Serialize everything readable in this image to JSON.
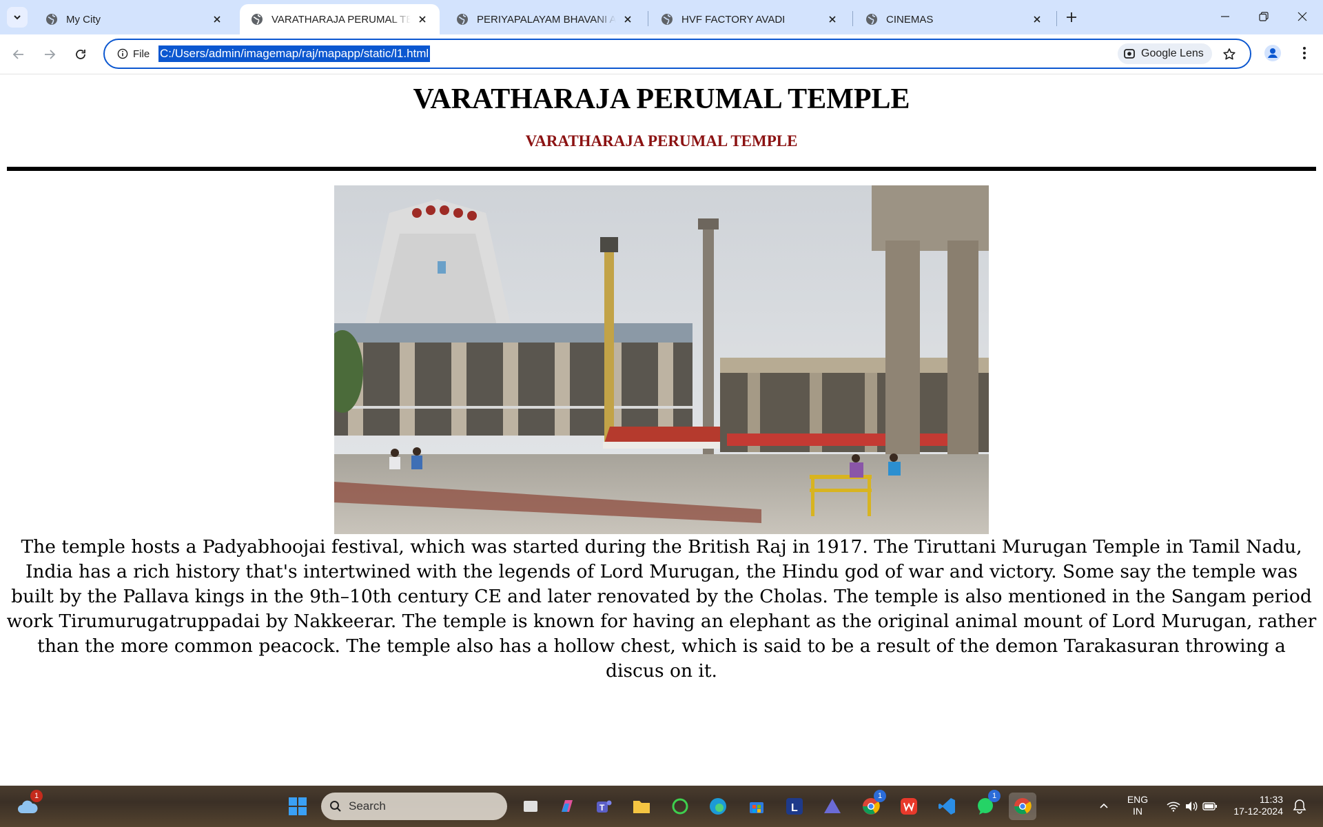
{
  "tabs": [
    {
      "title": "My City",
      "active": false
    },
    {
      "title": "VARATHARAJA PERUMAL TEMPLE",
      "active": true
    },
    {
      "title": "PERIYAPALAYAM BHAVANI AMMAN TEMPLE",
      "active": false
    },
    {
      "title": "HVF FACTORY AVADI",
      "active": false
    },
    {
      "title": "CINEMAS",
      "active": false
    }
  ],
  "toolbar": {
    "site_info_label": "File",
    "url": "C:/Users/admin/imagemap/raj/mapapp/static/l1.html",
    "lens_label": "Google Lens"
  },
  "page": {
    "heading": "VARATHARAJA PERUMAL TEMPLE",
    "subheading": "VARATHARAJA PERUMAL TEMPLE",
    "description": "The temple hosts a Padyabhoojai festival, which was started during the British Raj in 1917. The Tiruttani Murugan Temple in Tamil Nadu, India has a rich history that's intertwined with the legends of Lord Murugan, the Hindu god of war and victory. Some say the temple was built by the Pallava kings in the 9th–10th century CE and later renovated by the Cholas. The temple is also mentioned in the Sangam period work Tirumurugatruppadai by Nakkeerar. The temple is known for having an elephant as the original animal mount of Lord Murugan, rather than the more common peacock. The temple also has a hollow chest, which is said to be a result of the demon Tarakasuran throwing a discus on it."
  },
  "taskbar": {
    "search_label": "Search",
    "weather_badge": "1",
    "chrome_badge": "1",
    "whatsapp_badge": "1",
    "language": "ENG",
    "region": "IN",
    "time": "11:33",
    "date": "17-12-2024"
  },
  "colors": {
    "tab_strip": "#d3e3fd",
    "accent": "#0b57d0",
    "subheading": "#8b1212"
  }
}
